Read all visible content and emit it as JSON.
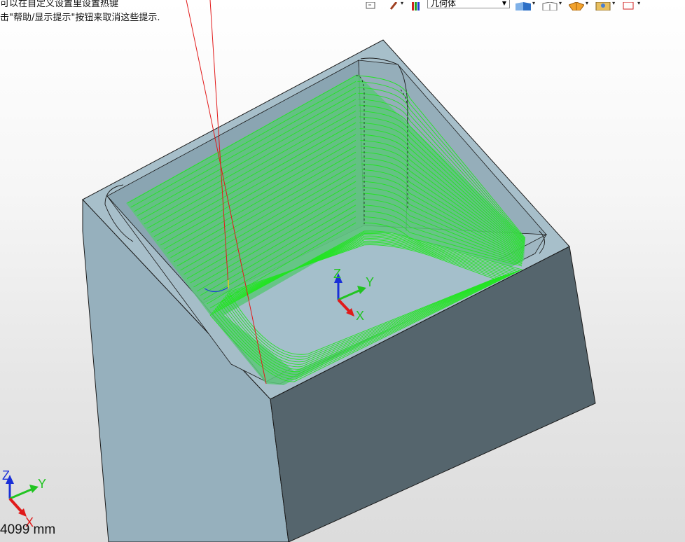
{
  "hints": {
    "line1": "可以在自定义设置里设置热键",
    "line2": "击\"帮助/显示提示\"按钮来取消这些提示."
  },
  "toolbar": {
    "items": [
      {
        "icon": "view-orient-icon"
      },
      {
        "icon": "pen-icon"
      },
      {
        "icon": "color-bars-icon"
      },
      {
        "icon": "shaded-cube-icon"
      },
      {
        "icon": "wire-cube-icon"
      },
      {
        "icon": "pie-color-icon"
      },
      {
        "icon": "photo-icon"
      },
      {
        "icon": "clip-plane-icon"
      }
    ],
    "view_select": {
      "value": "几何体"
    }
  },
  "triad_center": {
    "z": "Z",
    "y": "Y",
    "x": "X"
  },
  "triad_corner": {
    "z": "Z",
    "y": "Y",
    "x": "X"
  },
  "scale": {
    "text": "4099 mm"
  },
  "colors": {
    "block_top": "#a6bec9",
    "block_left": "#97b1bd",
    "block_right": "#55656d",
    "toolpath": "#23e423",
    "toolpath_fill": "#5cc57a",
    "tool_line": "#e21a1a",
    "axis_x": "#e01a1a",
    "axis_y": "#21c421",
    "axis_z": "#1a2fd8"
  }
}
